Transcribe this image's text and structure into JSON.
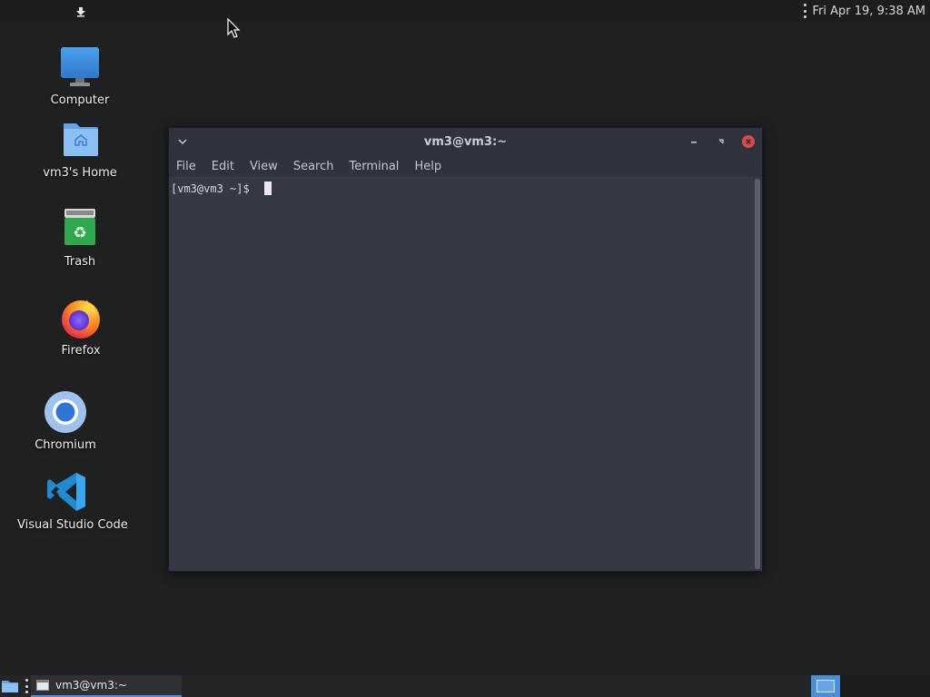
{
  "top_panel": {
    "clock": "Fri Apr 19,  9:38 AM"
  },
  "desktop": {
    "icons": [
      {
        "label": "Computer",
        "icon": "computer-icon"
      },
      {
        "label": "vm3's Home",
        "icon": "home-folder-icon"
      },
      {
        "label": "Trash",
        "icon": "trash-icon"
      },
      {
        "label": "Firefox",
        "icon": "firefox-icon"
      },
      {
        "label": "Chromium",
        "icon": "chromium-icon"
      },
      {
        "label": "Visual Studio Code",
        "icon": "vscode-icon"
      }
    ]
  },
  "terminal": {
    "title": "vm3@vm3:~",
    "menu": [
      "File",
      "Edit",
      "View",
      "Search",
      "Terminal",
      "Help"
    ],
    "prompt": "[vm3@vm3 ~]$ "
  },
  "taskbar": {
    "task_label": "vm3@vm3:~"
  },
  "colors": {
    "desktop_bg": "#1f2020",
    "terminal_bg": "#353945",
    "close_button": "#e0474c",
    "accent": "#4a90d9"
  }
}
